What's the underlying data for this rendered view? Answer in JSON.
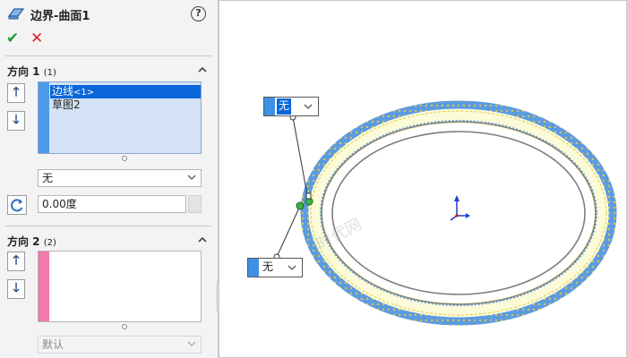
{
  "title_bar": {
    "title": "边界-曲面1",
    "help_icon": "?",
    "title_icon": "boundary-surface-icon"
  },
  "actions": {
    "ok_glyph": "✔",
    "cancel_glyph": "✕"
  },
  "direction1": {
    "label": "方向 1",
    "count": "(1)",
    "items": [
      {
        "name": "边线",
        "suffix": "<1>",
        "selected": true
      },
      {
        "name": "草图2",
        "suffix": "",
        "selected": false
      }
    ],
    "tangency_value": "无",
    "angle_value": "0.00度",
    "bar_color": "#4a9ae8"
  },
  "direction2": {
    "label": "方向 2",
    "count": "(2)",
    "items": [],
    "tangency_value": "默认",
    "bar_color": "#f07aac"
  },
  "graphics": {
    "callout_top_value": "无",
    "callout_bottom_value": "无",
    "watermark": "时代网"
  },
  "colors": {
    "accent_blue": "#0a66d8",
    "ok_green": "#1e9e2d",
    "cancel_red": "#e02020",
    "surface_yellow": "#fbfbd8"
  }
}
